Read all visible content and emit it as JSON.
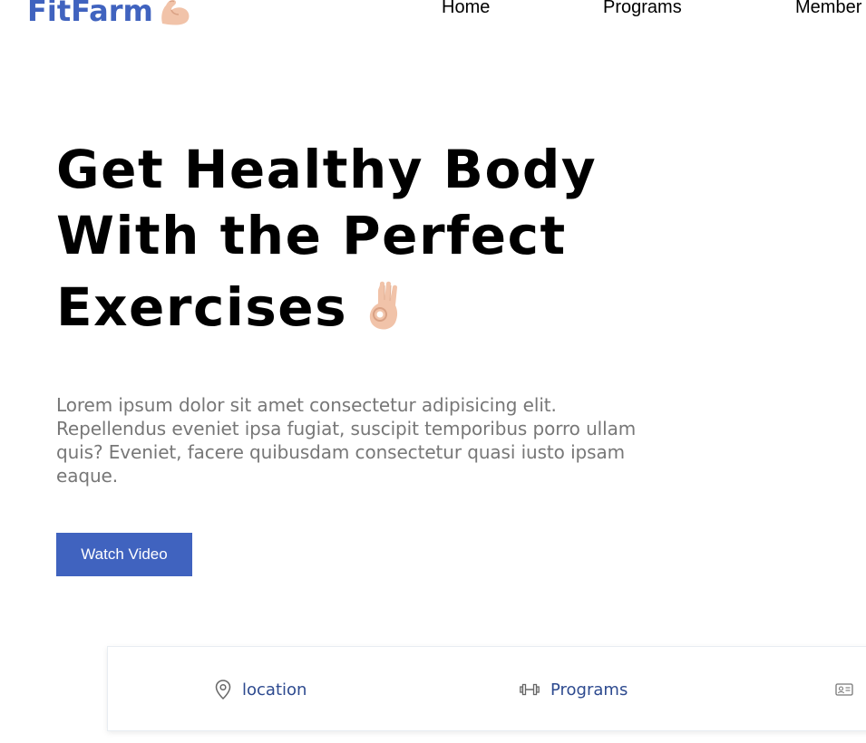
{
  "header": {
    "logo_text": "FitFarm",
    "logo_emoji": "flexed-biceps-icon",
    "nav": [
      {
        "label": "Home"
      },
      {
        "label": "Programs"
      },
      {
        "label": "Member"
      }
    ]
  },
  "hero": {
    "title_line1": "Get Healthy Body",
    "title_line2": "With the Perfect",
    "title_line3": "Exercises",
    "title_emoji": "ok-hand-icon",
    "description": "Lorem ipsum dolor sit amet consectetur adipisicing elit. Repellendus eveniet ipsa fugiat, suscipit temporibus porro ullam quis? Eveniet, facere quibusdam consectetur quasi iusto ipsam eaque.",
    "button_label": "Watch Video"
  },
  "info_bar": {
    "items": [
      {
        "label": "location",
        "icon": "map-pin-icon"
      },
      {
        "label": "Programs",
        "icon": "dumbbell-icon"
      },
      {
        "label": "",
        "icon": "id-card-icon"
      }
    ]
  },
  "colors": {
    "brand": "#4063bf",
    "info_text": "#2d4a8f",
    "desc_text": "#777777"
  }
}
